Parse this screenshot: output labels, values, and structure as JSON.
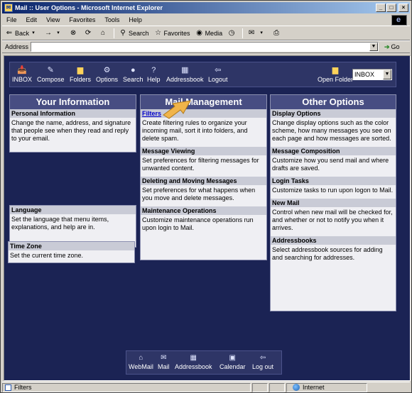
{
  "window": {
    "title": "Mail :: User Options - Microsoft Internet Explorer"
  },
  "menu": [
    "File",
    "Edit",
    "View",
    "Favorites",
    "Tools",
    "Help"
  ],
  "toolbar": {
    "back": "Back",
    "search": "Search",
    "favorites": "Favorites",
    "media": "Media"
  },
  "address": {
    "label": "Address",
    "value": "",
    "go": "Go"
  },
  "topnav": {
    "items": [
      "INBOX",
      "Compose",
      "Folders",
      "Options",
      "Search",
      "Help",
      "Addressbook",
      "Logout"
    ],
    "open_folder_label": "Open Folder",
    "folder_selected": "INBOX"
  },
  "columns": {
    "your_info": {
      "header": "Your Information",
      "sections": [
        {
          "title": "Personal Information",
          "body": "Change the name, address, and signature that people see when they read and reply to your email."
        },
        {
          "title": "Language",
          "body": "Set the language that menu items, explanations, and help are in."
        },
        {
          "title": "Time Zone",
          "body": "Set the current time zone."
        }
      ]
    },
    "mail_mgmt": {
      "header": "Mail Management",
      "sections": [
        {
          "title": "Filters",
          "body": "Create filtering rules to organize your incoming mail, sort it into folders, and delete spam."
        },
        {
          "title": "Message Viewing",
          "body": "Set preferences for filtering messages for unwanted content."
        },
        {
          "title": "Deleting and Moving Messages",
          "body": "Set preferences for what happens when you move and delete messages."
        },
        {
          "title": "Maintenance Operations",
          "body": "Customize maintenance operations run upon login to Mail."
        }
      ]
    },
    "other": {
      "header": "Other Options",
      "sections": [
        {
          "title": "Display Options",
          "body": "Change display options such as the color scheme, how many messages you see on each page and how messages are sorted."
        },
        {
          "title": "Message Composition",
          "body": "Customize how you send mail and where drafts are saved."
        },
        {
          "title": "Login Tasks",
          "body": "Customize tasks to run upon logon to Mail."
        },
        {
          "title": "New Mail",
          "body": "Control when new mail will be checked for, and whether or not to notify you when it arrives."
        },
        {
          "title": "Addressbooks",
          "body": "Select addressbook sources for adding and searching for addresses."
        }
      ]
    }
  },
  "bottomnav": {
    "items": [
      "WebMail",
      "Mail",
      "Addressbook",
      "Calendar",
      "Log out"
    ]
  },
  "status": {
    "text": "Filters",
    "zone": "Internet"
  },
  "colors": {
    "page_bg": "#1b2354",
    "header_bg": "#474d82",
    "section_bg": "#c9cbd6",
    "panel_bg": "#efeff3",
    "arrow": "#f0b44a"
  }
}
